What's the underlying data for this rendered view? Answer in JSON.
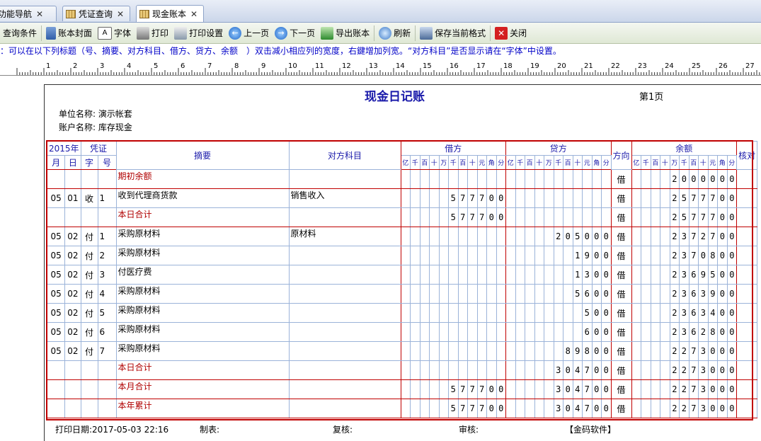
{
  "tabs": [
    {
      "label": "功能导航",
      "active": false
    },
    {
      "label": "凭证查询",
      "active": false
    },
    {
      "label": "现金账本",
      "active": true
    }
  ],
  "toolbar": {
    "query": "查询条件",
    "cover": "账本封面",
    "font": "字体",
    "print": "打印",
    "print_setup": "打印设置",
    "prev": "上一页",
    "next": "下一页",
    "export": "导出账本",
    "refresh": "刷新",
    "save_format": "保存当前格式",
    "close": "关闭"
  },
  "hint": "：可以在以下列标题（号、摘要、对方科目、借方、贷方、余额　）双击减小相应列的宽度，右鍵增加列宽。“对方科目”是否显示请在“字体”中设置。",
  "ruler": {
    "labels": [
      "1",
      "2",
      "3",
      "4",
      "5",
      "6",
      "7",
      "8",
      "9",
      "10",
      "11",
      "12",
      "13",
      "14",
      "15",
      "16",
      "17",
      "18",
      "19",
      "20",
      "21",
      "22",
      "23",
      "24",
      "25",
      "26",
      "27",
      "28"
    ]
  },
  "report": {
    "title": "现金日记账",
    "page": "第1页",
    "unit": "单位名称: 演示帐套",
    "account": "账户名称: 库存现金",
    "headers": {
      "year": "2015年",
      "voucher": "凭证",
      "month": "月",
      "day": "日",
      "zi": "字",
      "hao": "号",
      "summary": "摘要",
      "counter": "对方科目",
      "debit": "借方",
      "credit": "贷方",
      "dir": "方向",
      "balance": "余额",
      "check": "核对"
    },
    "digit_heads": [
      "亿",
      "千",
      "百",
      "十",
      "万",
      "千",
      "百",
      "十",
      "元",
      "角",
      "分"
    ],
    "rows": [
      {
        "m": "",
        "d": "",
        "z": "",
        "h": "",
        "summary": "期初余额",
        "red": true,
        "counter": "",
        "debit": "",
        "credit": "",
        "dir": "借",
        "balance": "2000000"
      },
      {
        "m": "05",
        "d": "01",
        "z": "收",
        "h": "1",
        "summary": "收到代理商货款",
        "red": false,
        "counter": "销售收入",
        "debit": "577700",
        "credit": "",
        "dir": "借",
        "balance": "2577700"
      },
      {
        "m": "",
        "d": "",
        "z": "",
        "h": "",
        "summary": "本日合计",
        "red": true,
        "counter": "",
        "debit": "577700",
        "credit": "",
        "dir": "借",
        "balance": "2577700"
      },
      {
        "m": "05",
        "d": "02",
        "z": "付",
        "h": "1",
        "summary": "采购原材料",
        "red": false,
        "counter": "原材料",
        "debit": "",
        "credit": "205000",
        "dir": "借",
        "balance": "2372700"
      },
      {
        "m": "05",
        "d": "02",
        "z": "付",
        "h": "2",
        "summary": "采购原材料",
        "red": false,
        "counter": "",
        "debit": "",
        "credit": "1900",
        "dir": "借",
        "balance": "2370800"
      },
      {
        "m": "05",
        "d": "02",
        "z": "付",
        "h": "3",
        "summary": "付医疗费",
        "red": false,
        "counter": "",
        "debit": "",
        "credit": "1300",
        "dir": "借",
        "balance": "2369500"
      },
      {
        "m": "05",
        "d": "02",
        "z": "付",
        "h": "4",
        "summary": "采购原材料",
        "red": false,
        "counter": "",
        "debit": "",
        "credit": "5600",
        "dir": "借",
        "balance": "2363900"
      },
      {
        "m": "05",
        "d": "02",
        "z": "付",
        "h": "5",
        "summary": "采购原材料",
        "red": false,
        "counter": "",
        "debit": "",
        "credit": "500",
        "dir": "借",
        "balance": "2363400"
      },
      {
        "m": "05",
        "d": "02",
        "z": "付",
        "h": "6",
        "summary": "采购原材料",
        "red": false,
        "counter": "",
        "debit": "",
        "credit": "600",
        "dir": "借",
        "balance": "2362800"
      },
      {
        "m": "05",
        "d": "02",
        "z": "付",
        "h": "7",
        "summary": "采购原材料",
        "red": false,
        "counter": "",
        "debit": "",
        "credit": "89800",
        "dir": "借",
        "balance": "2273000"
      },
      {
        "m": "",
        "d": "",
        "z": "",
        "h": "",
        "summary": "本日合计",
        "red": true,
        "counter": "",
        "debit": "",
        "credit": "304700",
        "dir": "借",
        "balance": "2273000"
      },
      {
        "m": "",
        "d": "",
        "z": "",
        "h": "",
        "summary": "本月合计",
        "red": true,
        "counter": "",
        "debit": "577700",
        "credit": "304700",
        "dir": "借",
        "balance": "2273000"
      },
      {
        "m": "",
        "d": "",
        "z": "",
        "h": "",
        "summary": "本年累计",
        "red": true,
        "counter": "",
        "debit": "577700",
        "credit": "304700",
        "dir": "借",
        "balance": "2273000"
      }
    ],
    "footer": {
      "print_date": "打印日期:2017-05-03 22:16",
      "maker": "制表:",
      "review": "复核:",
      "audit": "审核:",
      "brand": "【金码软件】"
    }
  }
}
